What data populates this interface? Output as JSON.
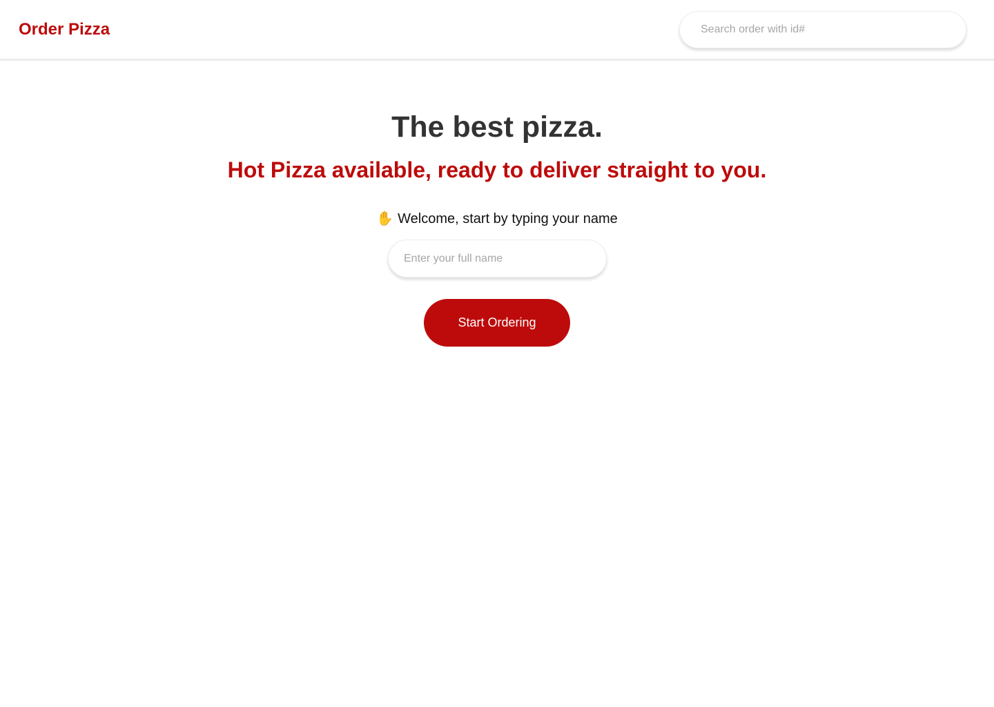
{
  "header": {
    "brand": "Order Pizza",
    "search_placeholder": "Search order with id#"
  },
  "hero": {
    "title": "The best pizza.",
    "subtitle": "Hot Pizza available, ready to deliver straight to you."
  },
  "welcome": {
    "icon": "waving-hand-icon",
    "text": "Welcome, start by typing your name"
  },
  "form": {
    "name_placeholder": "Enter your full name",
    "submit_label": "Start Ordering"
  },
  "colors": {
    "accent": "#bd0b0b",
    "heading": "#333333",
    "background": "#ffffff"
  }
}
